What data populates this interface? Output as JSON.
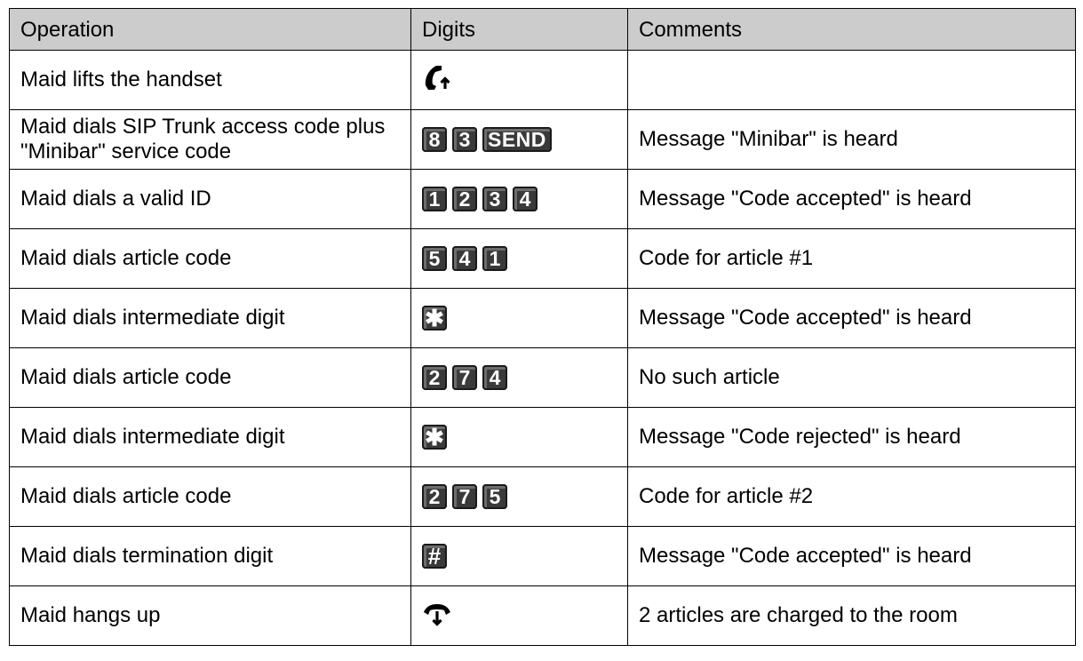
{
  "table": {
    "headers": [
      "Operation",
      "Digits",
      "Comments"
    ],
    "rows": [
      {
        "operation": "Maid lifts the handset",
        "icon": "handset-lift-icon",
        "keys": [],
        "comment": ""
      },
      {
        "operation": "Maid dials SIP Trunk access code plus \"Minibar\" service code",
        "keys": [
          "8",
          "3",
          "SEND"
        ],
        "comment": "Message \"Minibar\" is heard"
      },
      {
        "operation": "Maid dials a valid ID",
        "keys": [
          "1",
          "2",
          "3",
          "4"
        ],
        "comment": "Message \"Code accepted\" is heard"
      },
      {
        "operation": "Maid dials article code",
        "keys": [
          "5",
          "4",
          "1"
        ],
        "comment": "Code for article #1"
      },
      {
        "operation": "Maid dials intermediate digit",
        "keys": [
          "✱"
        ],
        "comment": "Message \"Code accepted\" is heard"
      },
      {
        "operation": "Maid dials article code",
        "keys": [
          "2",
          "7",
          "4"
        ],
        "comment": "No such article"
      },
      {
        "operation": "Maid dials intermediate digit",
        "keys": [
          "✱"
        ],
        "comment": "Message \"Code rejected\" is heard"
      },
      {
        "operation": "Maid dials article code",
        "keys": [
          "2",
          "7",
          "5"
        ],
        "comment": "Code for article #2"
      },
      {
        "operation": "Maid dials termination digit",
        "keys": [
          "#"
        ],
        "comment": "Message \"Code accepted\" is heard"
      },
      {
        "operation": "Maid hangs up",
        "icon": "handset-hangup-icon",
        "keys": [],
        "comment": "2 articles are charged to the room"
      }
    ]
  }
}
